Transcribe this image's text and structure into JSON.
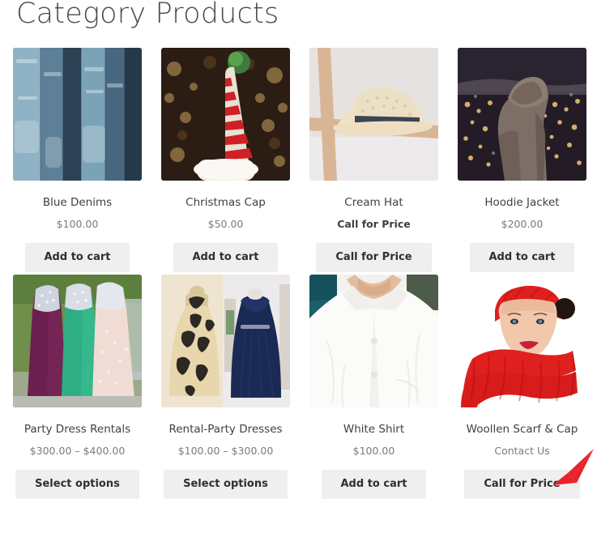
{
  "page": {
    "title": "Category Products"
  },
  "products": [
    {
      "name": "Blue Denims",
      "price": "$100.00",
      "price_is_callout": false,
      "button": "Add to cart",
      "image_name": "blue-denims-image"
    },
    {
      "name": "Christmas Cap",
      "price": "$50.00",
      "price_is_callout": false,
      "button": "Add to cart",
      "image_name": "christmas-cap-image"
    },
    {
      "name": "Cream Hat",
      "price": "Call for Price",
      "price_is_callout": true,
      "button": "Call for Price",
      "image_name": "cream-hat-image"
    },
    {
      "name": "Hoodie Jacket",
      "price": "$200.00",
      "price_is_callout": false,
      "button": "Add to cart",
      "image_name": "hoodie-jacket-image"
    },
    {
      "name": "Party Dress Rentals",
      "price": "$300.00 – $400.00",
      "price_is_callout": false,
      "button": "Select options",
      "image_name": "party-dress-rentals-image"
    },
    {
      "name": "Rental-Party Dresses",
      "price": "$100.00 – $300.00",
      "price_is_callout": false,
      "button": "Select options",
      "image_name": "rental-party-dresses-image"
    },
    {
      "name": "White Shirt",
      "price": "$100.00",
      "price_is_callout": false,
      "button": "Add to cart",
      "image_name": "white-shirt-image"
    },
    {
      "name": "Woollen Scarf & Cap",
      "price": "Contact Us",
      "price_is_callout": false,
      "button": "Call for Price",
      "image_name": "woollen-scarf-and-cap-image"
    }
  ],
  "annotation": {
    "name": "red-arrow-pointing-to-contact-us",
    "color": "#e8232a",
    "points_to": "Contact Us"
  },
  "colors": {
    "page_background": "#ffffff",
    "title_text": "#4a4a4a",
    "product_name_text": "#3f3f3f",
    "price_text": "#7b7b7b",
    "button_background": "#efefef",
    "button_text": "#2f2f2f",
    "annotation_red": "#e8232a"
  }
}
